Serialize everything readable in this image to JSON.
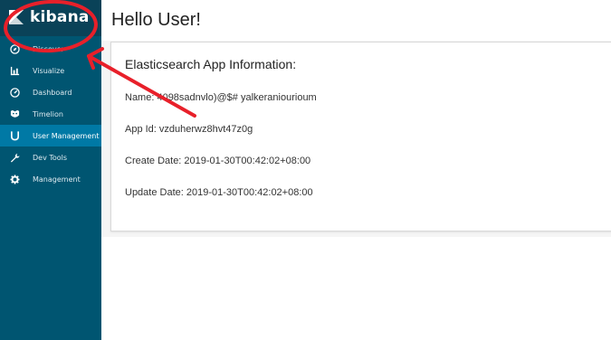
{
  "app": {
    "logo_text": "kibana"
  },
  "sidebar": {
    "items": [
      {
        "label": "Discover",
        "icon": "compass-icon",
        "active": false
      },
      {
        "label": "Visualize",
        "icon": "bar-chart-icon",
        "active": false
      },
      {
        "label": "Dashboard",
        "icon": "dashboard-icon",
        "active": false
      },
      {
        "label": "Timelion",
        "icon": "timelion-icon",
        "active": false
      },
      {
        "label": "User Management",
        "icon": "user-management-icon",
        "active": true
      },
      {
        "label": "Dev Tools",
        "icon": "wrench-icon",
        "active": false
      },
      {
        "label": "Management",
        "icon": "gear-icon",
        "active": false
      }
    ]
  },
  "header": {
    "title": "Hello  User!"
  },
  "panel": {
    "heading": "Elasticsearch App Information:",
    "name": "Name: 4098sadnvlo)@$# yalkeraniourioum",
    "app_id": "App Id: vzduherwz8hvt47z0g",
    "create_date": "Create Date: 2019-01-30T00:42:02+08:00",
    "update_date": "Update Date: 2019-01-30T00:42:02+08:00"
  },
  "colors": {
    "sidebar": "#005571",
    "sidebar_active": "#0079a5",
    "annotation": "#e8202a"
  }
}
